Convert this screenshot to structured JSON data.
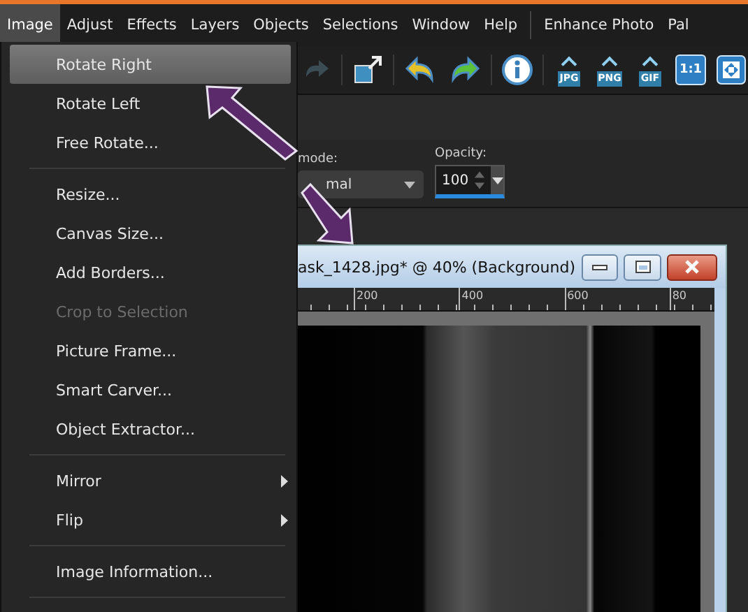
{
  "menu_bar": {
    "items": [
      {
        "label": "Image",
        "selected": true
      },
      {
        "label": "Adjust",
        "selected": false
      },
      {
        "label": "Effects",
        "selected": false
      },
      {
        "label": "Layers",
        "selected": false
      },
      {
        "label": "Objects",
        "selected": false
      },
      {
        "label": "Selections",
        "selected": false
      },
      {
        "label": "Window",
        "selected": false
      },
      {
        "label": "Help",
        "selected": false
      },
      {
        "label": "Enhance Photo",
        "selected": false
      },
      {
        "label": "Pal",
        "selected": false
      }
    ]
  },
  "toolbar": {
    "buttons": [
      {
        "kind": "redo-dim"
      },
      {
        "kind": "sep"
      },
      {
        "kind": "resize"
      },
      {
        "kind": "sep"
      },
      {
        "kind": "undo"
      },
      {
        "kind": "redo"
      },
      {
        "kind": "sep"
      },
      {
        "kind": "info"
      },
      {
        "kind": "sep"
      },
      {
        "kind": "export",
        "label": "JPG"
      },
      {
        "kind": "export",
        "label": "PNG"
      },
      {
        "kind": "export",
        "label": "GIF"
      },
      {
        "kind": "zoom",
        "label": "1:1"
      },
      {
        "kind": "fit"
      }
    ]
  },
  "options_bar": {
    "blend_mode": {
      "label": "mode:",
      "value": "mal"
    },
    "opacity": {
      "label": "Opacity:",
      "value": "100"
    }
  },
  "image_menu": {
    "items": [
      {
        "kind": "item",
        "label": "Rotate Right",
        "selected": true,
        "disabled": false,
        "submenu": false
      },
      {
        "kind": "item",
        "label": "Rotate Left",
        "selected": false,
        "disabled": false,
        "submenu": false
      },
      {
        "kind": "item",
        "label": "Free Rotate...",
        "selected": false,
        "disabled": false,
        "submenu": false
      },
      {
        "kind": "separator"
      },
      {
        "kind": "item",
        "label": "Resize...",
        "selected": false,
        "disabled": false,
        "submenu": false
      },
      {
        "kind": "item",
        "label": "Canvas Size...",
        "selected": false,
        "disabled": false,
        "submenu": false
      },
      {
        "kind": "item",
        "label": "Add Borders...",
        "selected": false,
        "disabled": false,
        "submenu": false
      },
      {
        "kind": "item",
        "label": "Crop to Selection",
        "selected": false,
        "disabled": true,
        "submenu": false
      },
      {
        "kind": "item",
        "label": "Picture Frame...",
        "selected": false,
        "disabled": false,
        "submenu": false
      },
      {
        "kind": "item",
        "label": "Smart Carver...",
        "selected": false,
        "disabled": false,
        "submenu": false
      },
      {
        "kind": "item",
        "label": "Object Extractor...",
        "selected": false,
        "disabled": false,
        "submenu": false
      },
      {
        "kind": "separator"
      },
      {
        "kind": "item",
        "label": "Mirror",
        "selected": false,
        "disabled": false,
        "submenu": true
      },
      {
        "kind": "item",
        "label": "Flip",
        "selected": false,
        "disabled": false,
        "submenu": true
      },
      {
        "kind": "separator"
      },
      {
        "kind": "item",
        "label": "Image Information...",
        "selected": false,
        "disabled": false,
        "submenu": false
      },
      {
        "kind": "separator"
      }
    ]
  },
  "document_window": {
    "title": "ask_1428.jpg* @  40% (Background)",
    "ruler_labels": [
      "200",
      "400",
      "600",
      "80"
    ]
  }
}
